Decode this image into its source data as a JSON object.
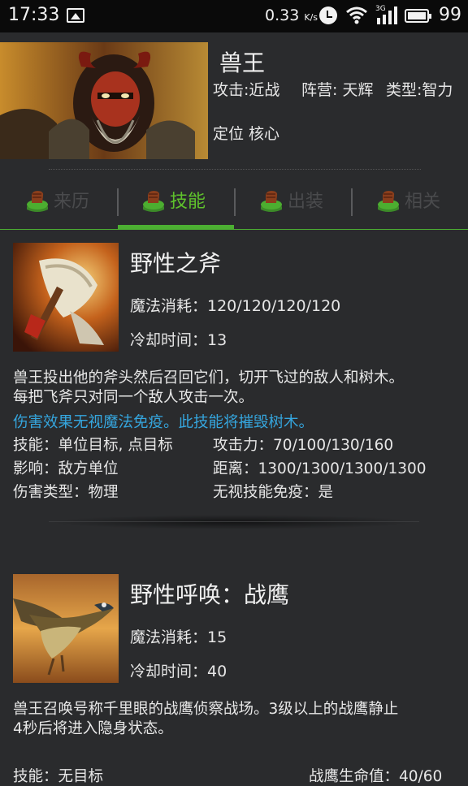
{
  "status_bar": {
    "time": "17:33",
    "net_speed": "0.33",
    "net_unit": "K/s",
    "network_type": "3G",
    "battery": "99"
  },
  "hero": {
    "name": "兽王",
    "attack": "攻击:近战",
    "faction": "阵营: 天辉",
    "type": "类型:智力",
    "role": "定位 核心"
  },
  "tabs": [
    {
      "label": "来历",
      "active": false
    },
    {
      "label": "技能",
      "active": true
    },
    {
      "label": "出装",
      "active": false
    },
    {
      "label": "相关",
      "active": false
    }
  ],
  "skills": [
    {
      "name": "野性之斧",
      "mana": "魔法消耗：120/120/120/120",
      "cooldown": "冷却时间：13",
      "desc_line1": "兽王投出他的斧头然后召回它们，切开飞过的敌人和树木。",
      "desc_line2": "每把飞斧只对同一个敌人攻击一次。",
      "note": "伤害效果无视魔法免疫。此技能将摧毁树木。",
      "props": {
        "ability": "技能：单位目标, 点目标",
        "damage": "攻击力：70/100/130/160",
        "affects": "影响：敌方单位",
        "range": "距离：1300/1300/1300/1300",
        "damage_type": "伤害类型：物理",
        "pierce": "无视技能免疫：是"
      }
    },
    {
      "name": "野性呼唤：战鹰",
      "mana": "魔法消耗：15",
      "cooldown": "冷却时间：40",
      "desc_line1": "兽王召唤号称千里眼的战鹰侦察战场。3级以上的战鹰静止",
      "desc_line2": "4秒后将进入隐身状态。",
      "props": {
        "ability": "技能：无目标",
        "hawk_hp": "战鹰生命值：40/60"
      }
    }
  ],
  "colors": {
    "accent_green": "#5fc22c",
    "note_blue": "#35a6de",
    "background": "#2a2b2d"
  }
}
